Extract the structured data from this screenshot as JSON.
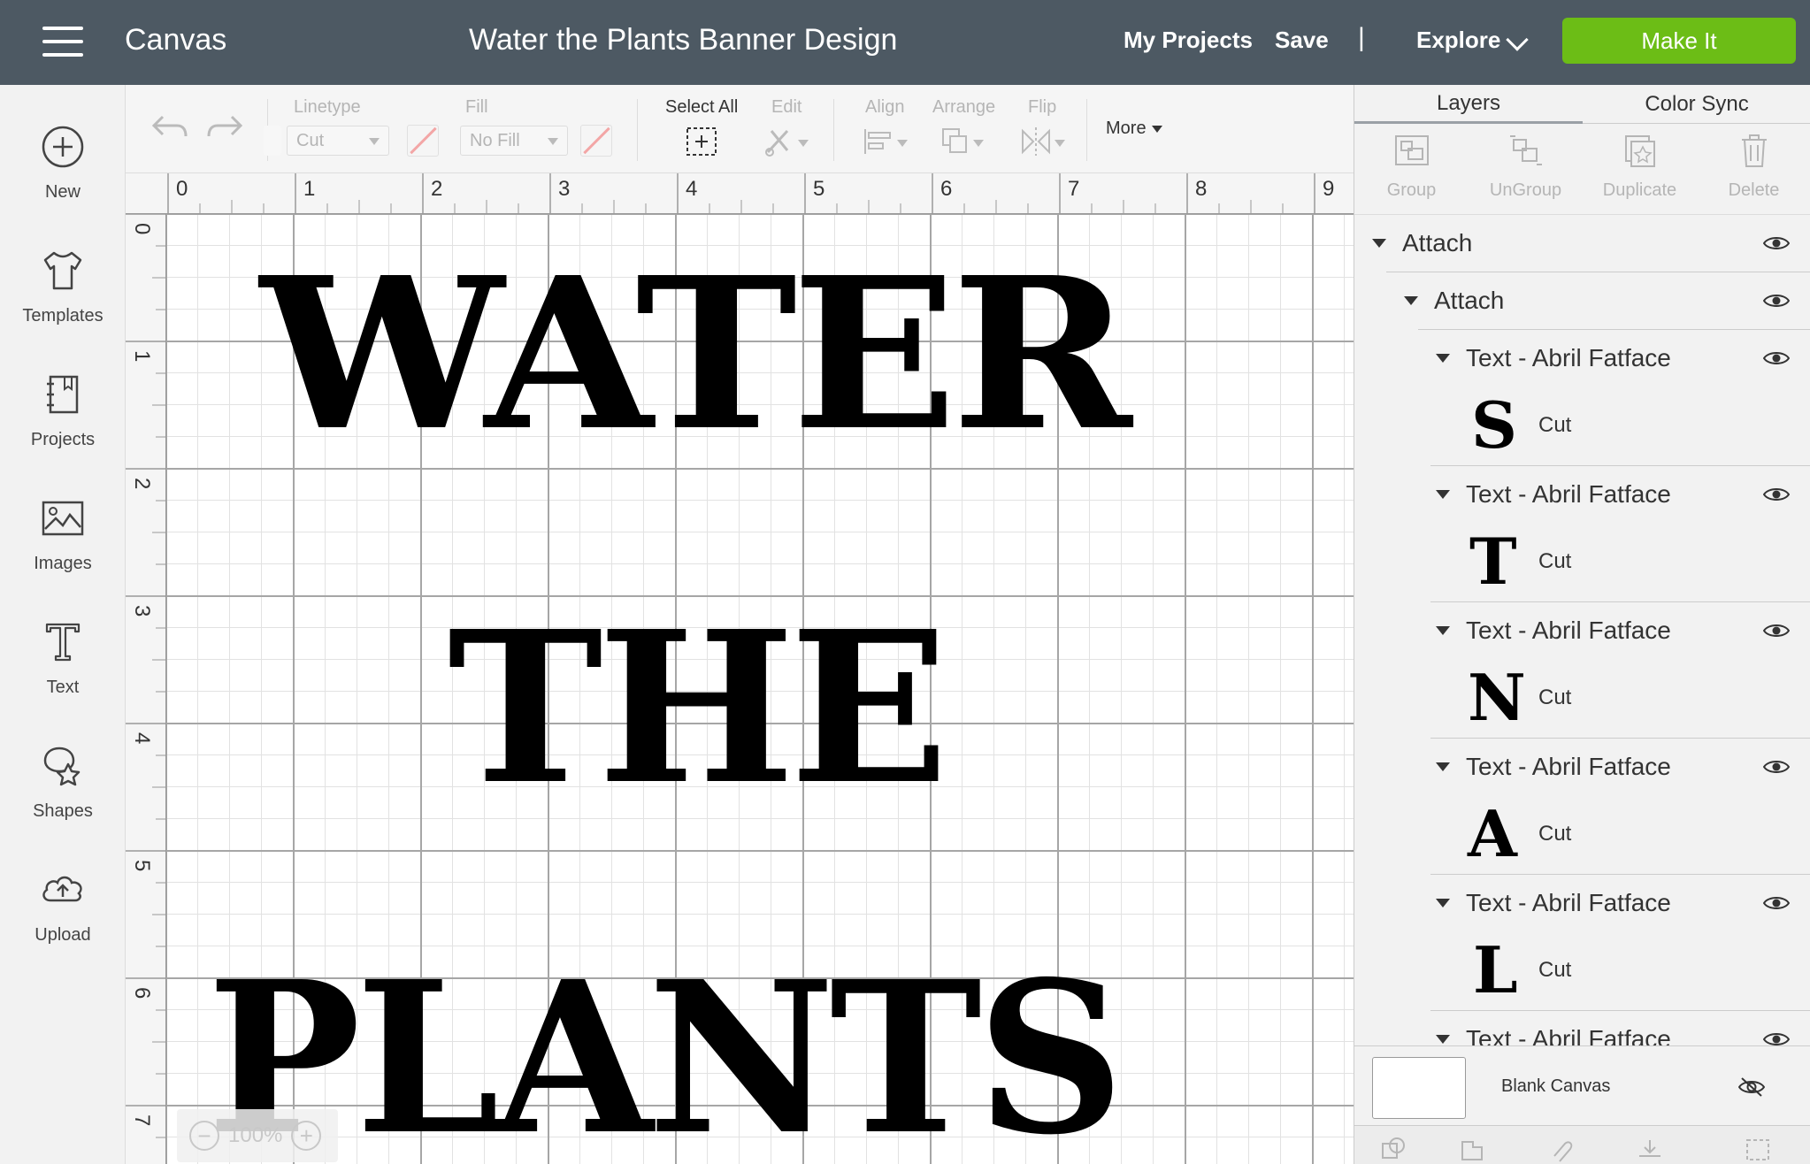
{
  "header": {
    "menu_icon": "hamburger-menu-icon",
    "app_name": "Canvas",
    "document_title": "Water the Plants Banner Design",
    "my_projects": "My Projects",
    "save": "Save",
    "separator": "|",
    "explore": "Explore",
    "make_it": "Make It",
    "make_it_color": "#6cbd16",
    "header_bg": "#4d5963"
  },
  "sidebar": {
    "items": [
      {
        "label": "New",
        "icon": "plus-circle-icon"
      },
      {
        "label": "Templates",
        "icon": "shirt-icon"
      },
      {
        "label": "Projects",
        "icon": "notebook-icon"
      },
      {
        "label": "Images",
        "icon": "image-icon"
      },
      {
        "label": "Text",
        "icon": "text-icon"
      },
      {
        "label": "Shapes",
        "icon": "shapes-icon"
      },
      {
        "label": "Upload",
        "icon": "cloud-upload-icon"
      }
    ]
  },
  "toolbar": {
    "linetype_label": "Linetype",
    "linetype_value": "Cut",
    "fill_label": "Fill",
    "fill_value": "No Fill",
    "select_all": "Select All",
    "edit": "Edit",
    "align": "Align",
    "arrange": "Arrange",
    "flip": "Flip",
    "more": "More"
  },
  "ruler": {
    "top": [
      "0",
      "1",
      "2",
      "3",
      "4",
      "5",
      "6",
      "7",
      "8",
      "9"
    ],
    "left": [
      "0",
      "1",
      "2",
      "3",
      "4",
      "5",
      "6",
      "7"
    ]
  },
  "canvas": {
    "lines": [
      "WATER",
      "THE",
      "PLANTS"
    ],
    "zoom": "100%",
    "zoom_out": "−",
    "zoom_in": "+"
  },
  "panel": {
    "tabs": [
      "Layers",
      "Color Sync"
    ],
    "actions": [
      "Group",
      "UnGroup",
      "Duplicate",
      "Delete"
    ],
    "groups": [
      {
        "name": "Attach"
      },
      {
        "name": "Attach"
      }
    ],
    "layers": [
      {
        "name": "Text - Abril Fatface",
        "glyph": "S",
        "op": "Cut"
      },
      {
        "name": "Text - Abril Fatface",
        "glyph": "T",
        "op": "Cut"
      },
      {
        "name": "Text - Abril Fatface",
        "glyph": "N",
        "op": "Cut"
      },
      {
        "name": "Text - Abril Fatface",
        "glyph": "A",
        "op": "Cut"
      },
      {
        "name": "Text - Abril Fatface",
        "glyph": "L",
        "op": "Cut"
      },
      {
        "name": "Text - Abril Fatface"
      }
    ],
    "blank_canvas": "Blank Canvas"
  }
}
